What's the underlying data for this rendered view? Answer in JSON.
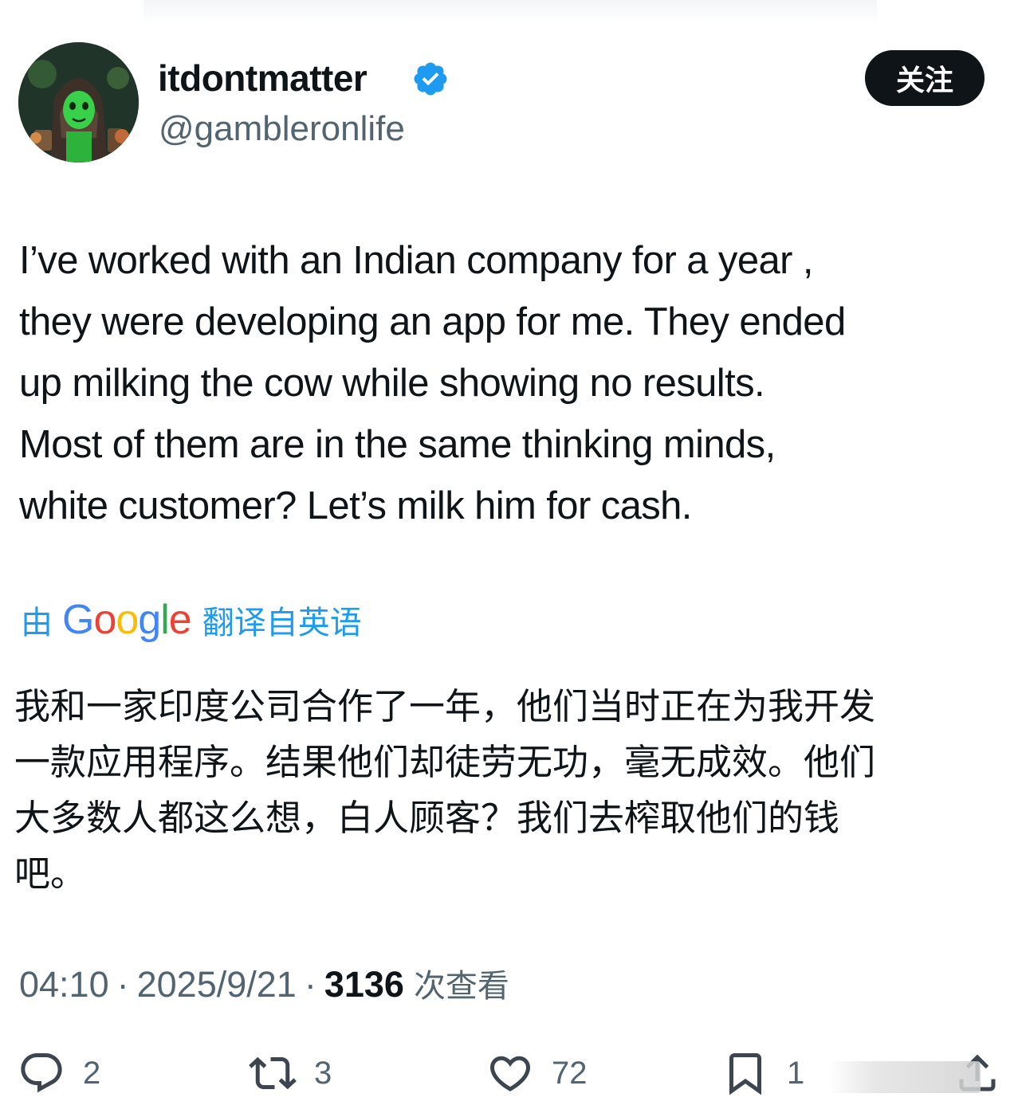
{
  "user": {
    "display_name": "itdontmatter",
    "handle": "@gambleronlife",
    "verified": true
  },
  "follow_button": {
    "label": "关注"
  },
  "tweet": {
    "text": "I’ve worked with an Indian company for a year ,\nthey were developing an app for me. They ended\nup milking the cow while showing no results.\nMost of them are in the same thinking minds,\nwhite customer? Let’s milk him for cash."
  },
  "translation": {
    "prefix": "由",
    "provider": "Google",
    "suffix": "翻译自英语",
    "text": "我和一家印度公司合作了一年，他们当时正在为我开发\n一款应用程序。结果他们却徒劳无功，毫无成效。他们\n大多数人都这么想，白人顾客？我们去榨取他们的钱\n吧。"
  },
  "meta": {
    "time": "04:10",
    "separator": "·",
    "date": "2025/9/21",
    "views_count": "3136",
    "views_label": "次查看"
  },
  "actions": {
    "reply": {
      "icon": "reply-icon",
      "count": "2"
    },
    "retweet": {
      "icon": "retweet-icon",
      "count": "3"
    },
    "like": {
      "icon": "heart-icon",
      "count": "72"
    },
    "bookmark": {
      "icon": "bookmark-icon",
      "count": "1"
    },
    "share": {
      "icon": "share-icon"
    }
  },
  "colors": {
    "text": "#0f1419",
    "secondary": "#536471",
    "accent": "#1d9bf0",
    "follow_bg": "#0f1419"
  }
}
